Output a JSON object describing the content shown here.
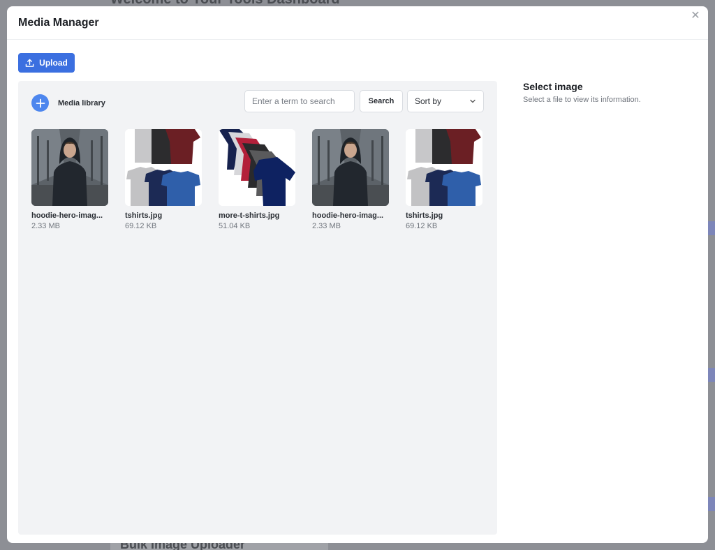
{
  "background": {
    "heading": "Welcome to Your Tools Dashboard",
    "footer_title": "Bulk Image Uploader",
    "accent": "#7d86b9"
  },
  "modal": {
    "title": "Media Manager",
    "close_icon": "close-icon"
  },
  "toolbar": {
    "upload_label": "Upload",
    "upload_icon": "upload-icon",
    "accent": "#3b6fe0"
  },
  "library": {
    "label": "Media library",
    "add_icon": "plus-circle-icon",
    "search": {
      "placeholder": "Enter a term to search",
      "value": "",
      "button_label": "Search"
    },
    "sort": {
      "selected": "Sort by",
      "icon": "chevron-down-icon"
    },
    "items": [
      {
        "name": "hoodie-hero-imag...",
        "size": "2.33 MB",
        "thumb": "hoodie"
      },
      {
        "name": "tshirts.jpg",
        "size": "69.12 KB",
        "thumb": "tshirts"
      },
      {
        "name": "more-t-shirts.jpg",
        "size": "51.04 KB",
        "thumb": "more-tshirts"
      },
      {
        "name": "hoodie-hero-imag...",
        "size": "2.33 MB",
        "thumb": "hoodie"
      },
      {
        "name": "tshirts.jpg",
        "size": "69.12 KB",
        "thumb": "tshirts"
      }
    ]
  },
  "info_panel": {
    "title": "Select image",
    "subtitle": "Select a file to view its information."
  }
}
